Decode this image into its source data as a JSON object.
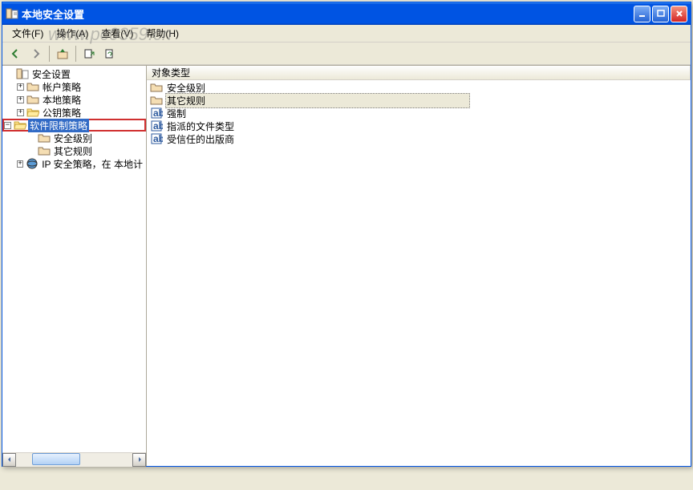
{
  "window": {
    "title": "本地安全设置"
  },
  "menu": {
    "file": "文件(F)",
    "action": "操作(A)",
    "view": "查看(V)",
    "help": "帮助(H)"
  },
  "tree": {
    "root": "安全设置",
    "account_policy": "帐户策略",
    "local_policy": "本地策略",
    "pubkey_policy": "公钥策略",
    "software_restriction": "软件限制策略",
    "security_level": "安全级别",
    "other_rules": "其它规则",
    "ip_policy": "IP 安全策略，在 本地计"
  },
  "list": {
    "col_type": "对象类型",
    "items": {
      "security_level": "安全级别",
      "other_rules": "其它规则",
      "enforce": "强制",
      "file_types": "指派的文件类型",
      "trusted_pub": "受信任的出版商"
    }
  },
  "watermark": "www.pc0359.cn"
}
